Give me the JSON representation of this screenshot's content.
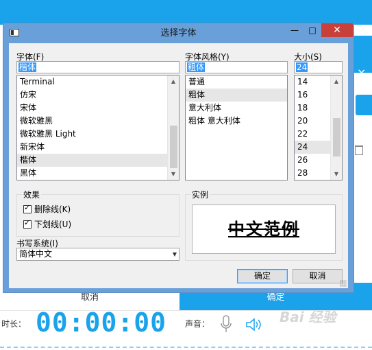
{
  "background_app": {
    "cancel_label": "取消",
    "ok_label": "确定",
    "duration_label": "时长：",
    "timer_value": "00:00:00",
    "sound_label": "声音：",
    "watermark_text": "Bai 经验",
    "side_close": "×",
    "accent_color": "#1aa3ea"
  },
  "dialog": {
    "title": "选择字体",
    "minimize": "—",
    "maximize": "□",
    "close": "✕",
    "font": {
      "label": "字体(F)",
      "value": "楷体",
      "items": [
        "Terminal",
        "仿宋",
        "宋体",
        "微软雅黑",
        "微软雅黑 Light",
        "新宋体",
        "楷体",
        "黑体"
      ],
      "selected": "楷体"
    },
    "style": {
      "label": "字体风格(Y)",
      "value": "粗体",
      "items": [
        "普通",
        "粗体",
        "意大利体",
        "粗体 意大利体"
      ],
      "selected": "粗体"
    },
    "size": {
      "label": "大小(S)",
      "value": "24",
      "items": [
        "14",
        "16",
        "18",
        "20",
        "22",
        "24",
        "26",
        "28"
      ],
      "selected": "24"
    },
    "effects": {
      "label": "效果",
      "strikeout": {
        "label": "删除线(K)",
        "checked": true
      },
      "underline": {
        "label": "下划线(U)",
        "checked": true
      }
    },
    "writing_system": {
      "label": "书写系统(I)",
      "value": "简体中文"
    },
    "sample": {
      "label": "实例",
      "text": "中文范例"
    },
    "ok_button": "确定",
    "cancel_button": "取消"
  }
}
